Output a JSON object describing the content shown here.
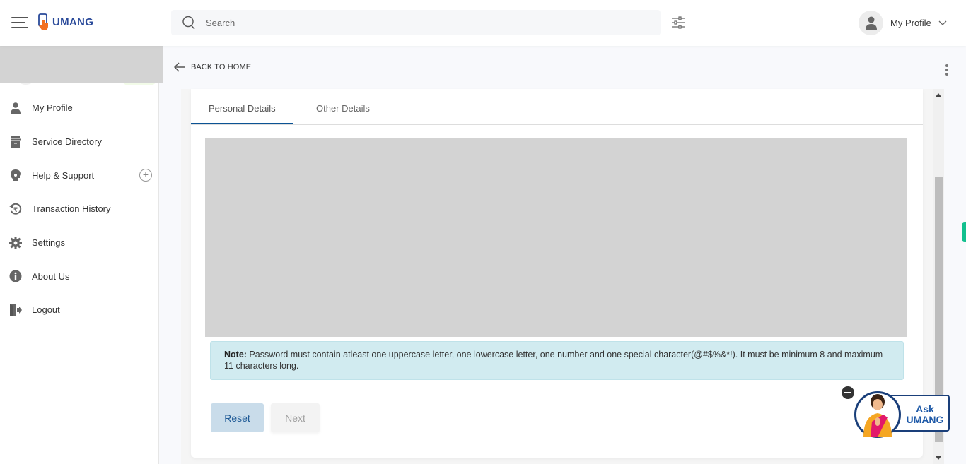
{
  "header": {
    "app_name": "UMANG",
    "search_placeholder": "Search",
    "profile_label": "My Profile"
  },
  "sidebar": {
    "items": [
      {
        "label": "My Profile",
        "icon": "user-icon"
      },
      {
        "label": "Service Directory",
        "icon": "archive-icon"
      },
      {
        "label": "Help & Support",
        "icon": "headset-icon",
        "expandable": true
      },
      {
        "label": "Transaction History",
        "icon": "rupee-history-icon"
      },
      {
        "label": "Settings",
        "icon": "gear-icon"
      },
      {
        "label": "About Us",
        "icon": "info-icon"
      },
      {
        "label": "Logout",
        "icon": "logout-icon"
      }
    ],
    "expand_symbol": "+"
  },
  "main": {
    "back_label": "BACK TO HOME",
    "tabs": [
      {
        "label": "Personal Details",
        "active": true
      },
      {
        "label": "Other Details",
        "active": false
      }
    ],
    "note_label": "Note:",
    "note_text": " Password must contain atleast one uppercase letter, one lowercase letter, one number and one special character(@#$%&*!). It must be minimum 8 and maximum 11 characters long.",
    "buttons": {
      "reset": "Reset",
      "next": "Next"
    }
  },
  "chatbot": {
    "label_line1": "Ask",
    "label_line2": "UMANG"
  },
  "colors": {
    "brand_blue": "#2a4a9a",
    "tab_active": "#0b5394",
    "note_bg": "#d1ebf0",
    "reset_bg": "#c9dcea",
    "accent_green": "#12c08e"
  }
}
